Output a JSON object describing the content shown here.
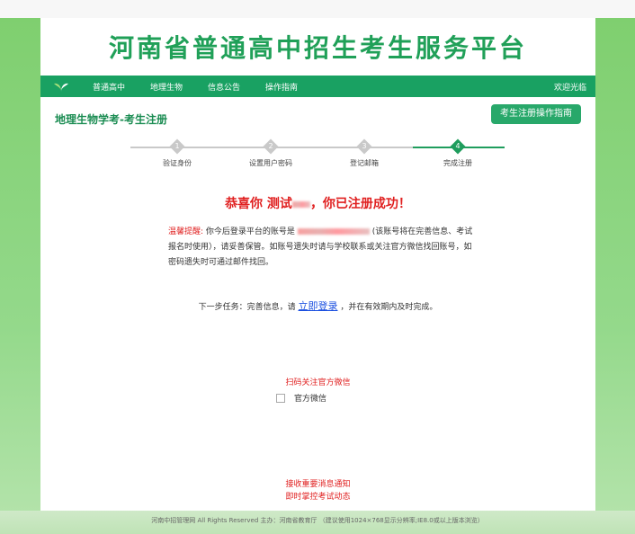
{
  "header": {
    "title": "河南省普通高中招生考生服务平台"
  },
  "nav": {
    "items": [
      "普通高中",
      "地理生物",
      "信息公告",
      "操作指南"
    ],
    "welcome": "欢迎光临"
  },
  "subhead": {
    "title": "地理生物学考-考生注册",
    "guide_button": "考生注册操作指南"
  },
  "steps": [
    {
      "num": "1",
      "label": "验证身份",
      "active": false
    },
    {
      "num": "2",
      "label": "设置用户密码",
      "active": false
    },
    {
      "num": "3",
      "label": "登记邮箱",
      "active": false
    },
    {
      "num": "4",
      "label": "完成注册",
      "active": true
    }
  ],
  "success": {
    "prefix": "恭喜你 测试",
    "suffix": "，你已注册成功！"
  },
  "notice": {
    "label": "温馨提醒:",
    "text1": "你今后登录平台的账号是",
    "text2": "(该账号将在完善信息、考试报名时使用），请妥善保管。如账号遗失时请与学校联系或关注官方微信找回账号，如密码遗失时可通过邮件找回。"
  },
  "next": {
    "prefix": "下一步任务：完善信息，请",
    "link": "立即登录",
    "suffix": "，并在有效期内及时完成。"
  },
  "wechat": {
    "scan_text": "扫码关注官方微信",
    "img_alt": "官方微信"
  },
  "info": {
    "line1": "接收重要消息通知",
    "line2": "即时掌控考试动态"
  },
  "footer": {
    "text": "河南中招管理网 All Rights Reserved 主办：河南省教育厅 （建议使用1024×768显示分辨率;IE8.0或以上版本浏览）"
  },
  "colors": {
    "brand": "#19a162",
    "title": "#20a058",
    "alert": "#e02020",
    "link": "#1a4fe0"
  }
}
